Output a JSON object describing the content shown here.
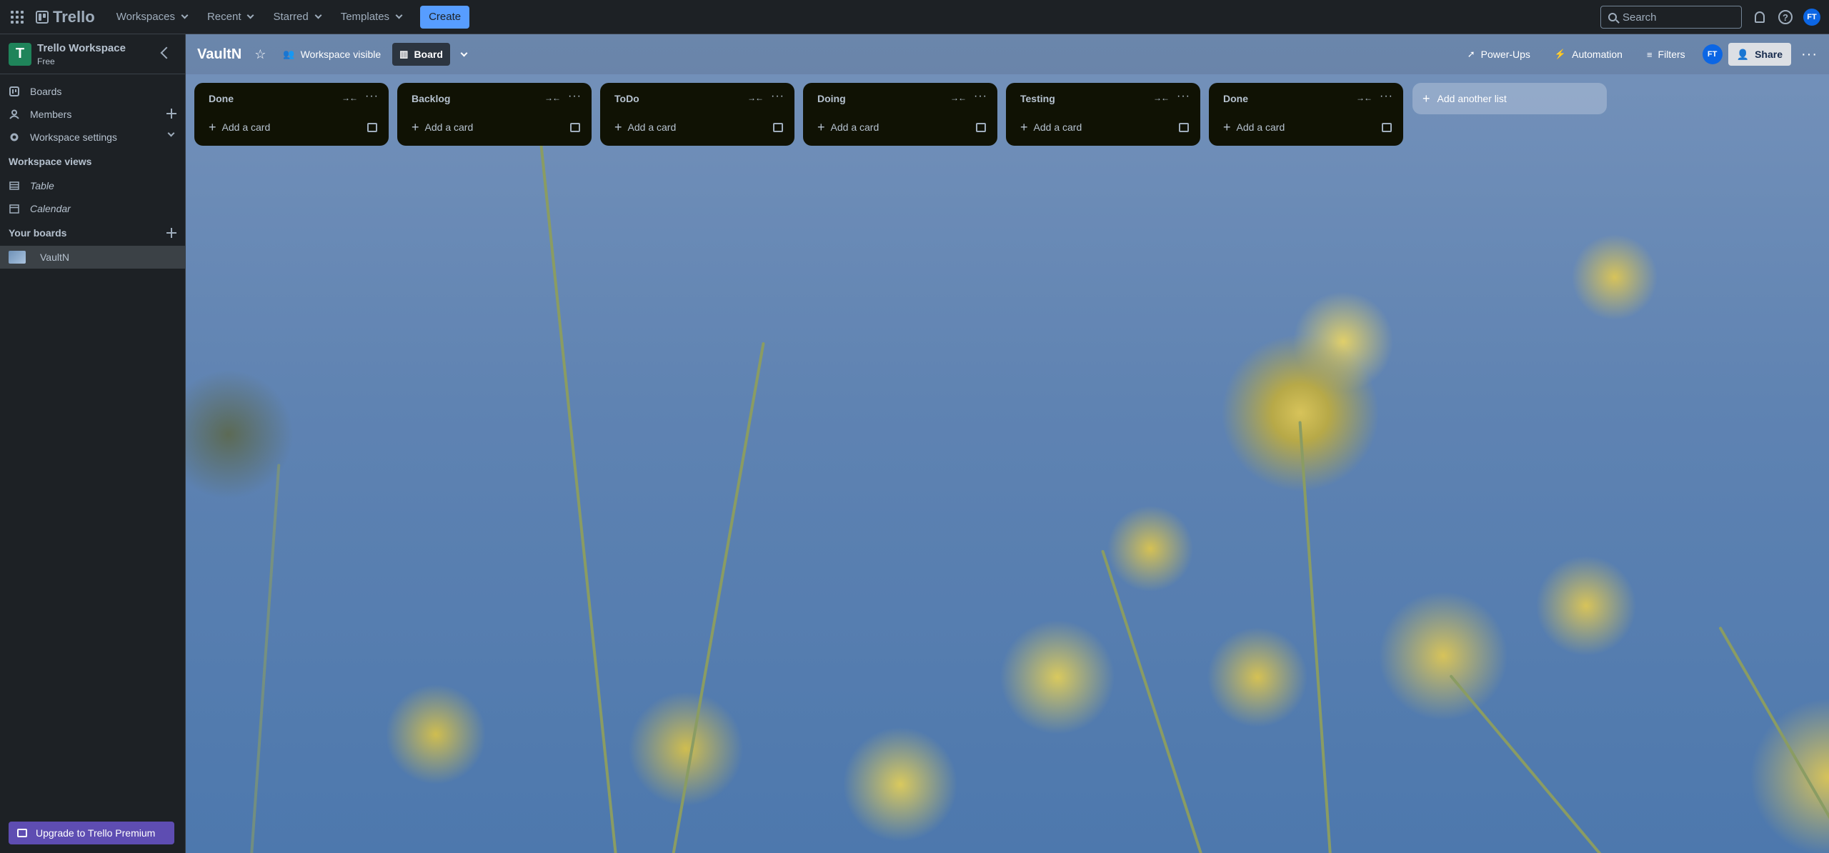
{
  "topbar": {
    "logo": "Trello",
    "nav": [
      {
        "label": "Workspaces"
      },
      {
        "label": "Recent"
      },
      {
        "label": "Starred"
      },
      {
        "label": "Templates"
      }
    ],
    "create_label": "Create",
    "search_placeholder": "Search",
    "avatar_initials": "FT"
  },
  "sidebar": {
    "workspace_initial": "T",
    "workspace_name": "Trello Workspace",
    "workspace_plan": "Free",
    "items": [
      {
        "label": "Boards"
      },
      {
        "label": "Members"
      },
      {
        "label": "Workspace settings"
      }
    ],
    "views_heading": "Workspace views",
    "views": [
      {
        "label": "Table"
      },
      {
        "label": "Calendar"
      }
    ],
    "boards_heading": "Your boards",
    "boards": [
      {
        "label": "VaultN"
      }
    ],
    "upgrade_label": "Upgrade to Trello Premium"
  },
  "board": {
    "title": "VaultN",
    "visibility_label": "Workspace visible",
    "view_label": "Board",
    "powerups_label": "Power-Ups",
    "automation_label": "Automation",
    "filters_label": "Filters",
    "member_initials": "FT",
    "share_label": "Share",
    "lists": [
      {
        "title": "Done",
        "add_card": "Add a card"
      },
      {
        "title": "Backlog",
        "add_card": "Add a card"
      },
      {
        "title": "ToDo",
        "add_card": "Add a card"
      },
      {
        "title": "Doing",
        "add_card": "Add a card"
      },
      {
        "title": "Testing",
        "add_card": "Add a card"
      },
      {
        "title": "Done",
        "add_card": "Add a card"
      }
    ],
    "add_list_label": "Add another list"
  },
  "colors": {
    "accent": "#579dff",
    "upgrade": "#5e4db2",
    "workspace_logo": "#1f845a",
    "list_bg": "#101204"
  }
}
